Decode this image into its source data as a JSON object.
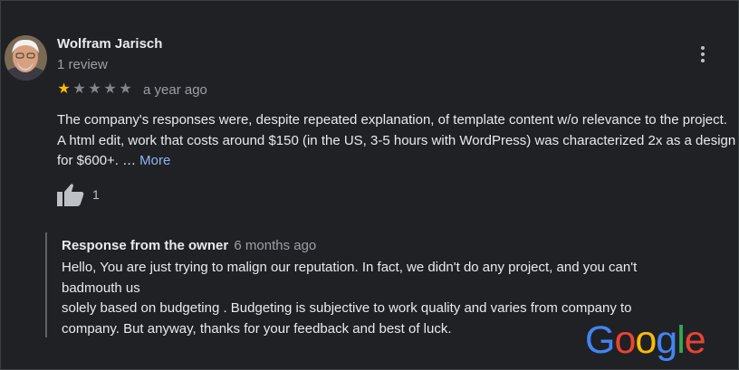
{
  "review": {
    "reviewer_name": "Wolfram Jarisch",
    "review_count": "1 review",
    "rating": 1,
    "rating_max": 5,
    "date": "a year ago",
    "text": "The company's responses were, despite repeated explanation, of template content w/o relevance to the project. A html edit, work that costs around $150 (in the US, 3-5 hours with WordPress) was characterized 2x as a design for $600+. …",
    "more_label": "More",
    "like_count": "1"
  },
  "owner_response": {
    "label": "Response from the owner",
    "date": "6 months ago",
    "lines": [
      "Hello, You are just trying to malign our reputation. In fact, we didn't do any project, and you can't",
      "badmouth us",
      "solely based on budgeting . Budgeting is subjective to work quality and varies from company to",
      "company. But anyway, thanks for your feedback and best of luck."
    ]
  },
  "logo": {
    "letters": [
      "G",
      "o",
      "o",
      "g",
      "l",
      "e"
    ],
    "colors": [
      "#4285f4",
      "#ea4335",
      "#fbbc05",
      "#4285f4",
      "#34a853",
      "#ea4335"
    ]
  },
  "colors": {
    "background": "#202124",
    "star_filled": "#fbbc04",
    "star_empty": "#80868b",
    "link": "#8ab4f8"
  },
  "icons": [
    "avatar",
    "more-vert-icon",
    "star-icon",
    "thumbs-up-icon",
    "google-logo"
  ]
}
